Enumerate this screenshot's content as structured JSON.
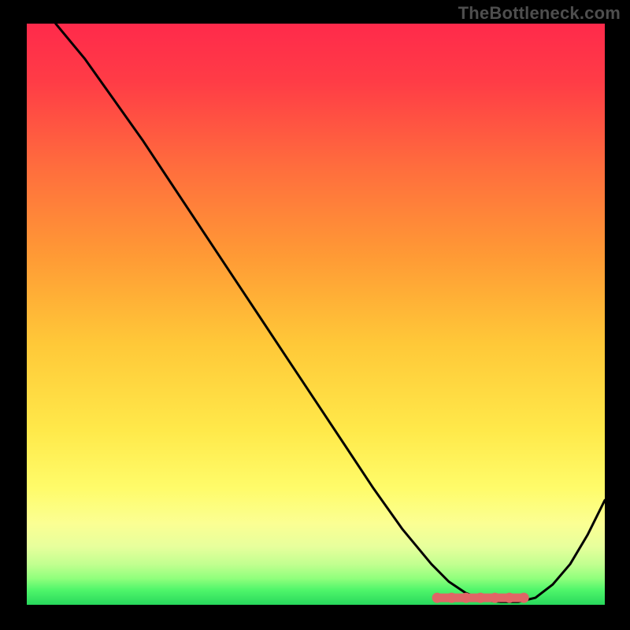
{
  "watermark": "TheBottleneck.com",
  "colors": {
    "frame": "#000000",
    "curve": "#000000",
    "marker": "#E06666",
    "gradient_stops": [
      {
        "offset": 0.0,
        "color": "#FF2A4B"
      },
      {
        "offset": 0.1,
        "color": "#FF3C46"
      },
      {
        "offset": 0.25,
        "color": "#FF6E3D"
      },
      {
        "offset": 0.4,
        "color": "#FF9A35"
      },
      {
        "offset": 0.55,
        "color": "#FFC838"
      },
      {
        "offset": 0.7,
        "color": "#FFE94A"
      },
      {
        "offset": 0.8,
        "color": "#FFFC6A"
      },
      {
        "offset": 0.86,
        "color": "#FBFF93"
      },
      {
        "offset": 0.9,
        "color": "#E7FF9C"
      },
      {
        "offset": 0.93,
        "color": "#C2FF90"
      },
      {
        "offset": 0.955,
        "color": "#8FFF7C"
      },
      {
        "offset": 0.975,
        "color": "#4EF56A"
      },
      {
        "offset": 1.0,
        "color": "#28D85C"
      }
    ]
  },
  "chart_data": {
    "type": "line",
    "title": "",
    "xlabel": "",
    "ylabel": "",
    "xlim": [
      0,
      100
    ],
    "ylim": [
      0,
      100
    ],
    "grid": false,
    "series": [
      {
        "name": "bottleneck-curve",
        "x": [
          5,
          10,
          15,
          20,
          25,
          30,
          35,
          40,
          45,
          50,
          55,
          60,
          65,
          70,
          73,
          76,
          79,
          82,
          85,
          88,
          91,
          94,
          97,
          100
        ],
        "y": [
          100,
          94,
          87,
          80,
          72.5,
          65,
          57.5,
          50,
          42.5,
          35,
          27.5,
          20,
          13,
          7,
          4,
          2,
          0.8,
          0.5,
          0.5,
          1.2,
          3.5,
          7,
          12,
          18
        ]
      }
    ],
    "annotations": [
      {
        "name": "optimal-flat-segment",
        "x_range": [
          71,
          86
        ],
        "y": 1.2
      }
    ]
  }
}
